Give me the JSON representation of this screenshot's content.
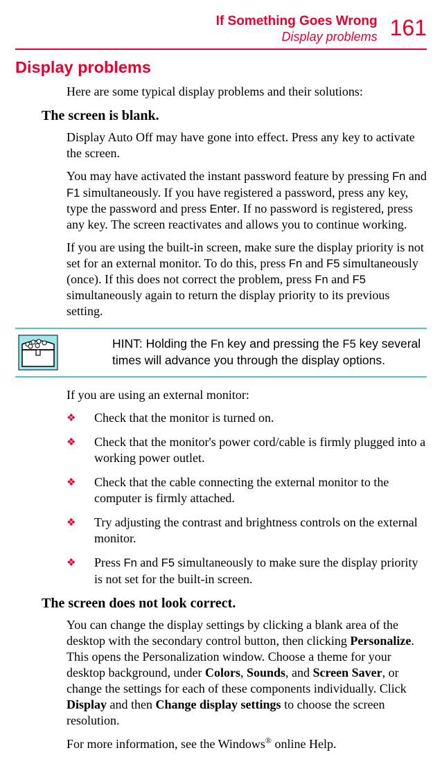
{
  "header": {
    "chapter": "If Something Goes Wrong",
    "section": "Display problems",
    "page_number": "161"
  },
  "section_title": "Display problems",
  "intro": "Here are some typical display problems and their solutions:",
  "sub1": {
    "heading": "The screen is blank.",
    "p1": "Display Auto Off may have gone into effect. Press any key to activate the screen.",
    "p2a": "You may have activated the instant password feature by pressing ",
    "k_fn1": "Fn",
    "p2b": " and ",
    "k_f1": "F1",
    "p2c": " simultaneously. If you have registered a password, press any key, type the password and press ",
    "k_enter": "Enter",
    "p2d": ". If no password is registered, press any key. The screen reactivates and allows you to continue working.",
    "p3a": "If you are using the built-in screen, make sure the display priority is not set for an external monitor. To do this, press ",
    "k_fn2": "Fn",
    "p3b": " and ",
    "k_f5a": "F5",
    "p3c": " simultaneously (once). If this does not correct the problem, press ",
    "k_fn3": "Fn",
    "p3d": " and ",
    "k_f5b": "F5",
    "p3e": " simultaneously again to return the display priority to its previous setting."
  },
  "hint": {
    "a": "HINT: Holding the ",
    "k_fn": "Fn",
    "b": " key and pressing the ",
    "k_f5": "F5",
    "c": " key several times will advance you through the display options."
  },
  "ext_intro": "If you are using an external monitor:",
  "bullets": {
    "b1": "Check that the monitor is turned on.",
    "b2": "Check that the monitor's power cord/cable is firmly plugged into a working power outlet.",
    "b3": "Check that the cable connecting the external monitor to the computer is firmly attached.",
    "b4": "Try adjusting the contrast and brightness controls on the external monitor.",
    "b5a": "Press ",
    "b5_fn": "Fn",
    "b5b": " and ",
    "b5_f5": "F5",
    "b5c": " simultaneously to make sure the display priority is not set for the built-in screen."
  },
  "sub2": {
    "heading": "The screen does not look correct.",
    "p1a": "You can change the display settings by clicking a blank area of the desktop with the secondary control button, then clicking ",
    "p1_personalize": "Personalize",
    "p1b": ". This opens the Personalization window. Choose a theme for your desktop background, under ",
    "p1_colors": "Colors",
    "p1c": ", ",
    "p1_sounds": "Sounds",
    "p1d": ", and ",
    "p1_ss": "Screen Saver",
    "p1e": ", or change the settings for each of these components individually. Click ",
    "p1_display": "Display",
    "p1f": " and then ",
    "p1_cds": "Change display settings",
    "p1g": " to choose the screen resolution.",
    "p2a": "For more information, see the Windows",
    "p2_reg": "®",
    "p2b": " online Help."
  }
}
